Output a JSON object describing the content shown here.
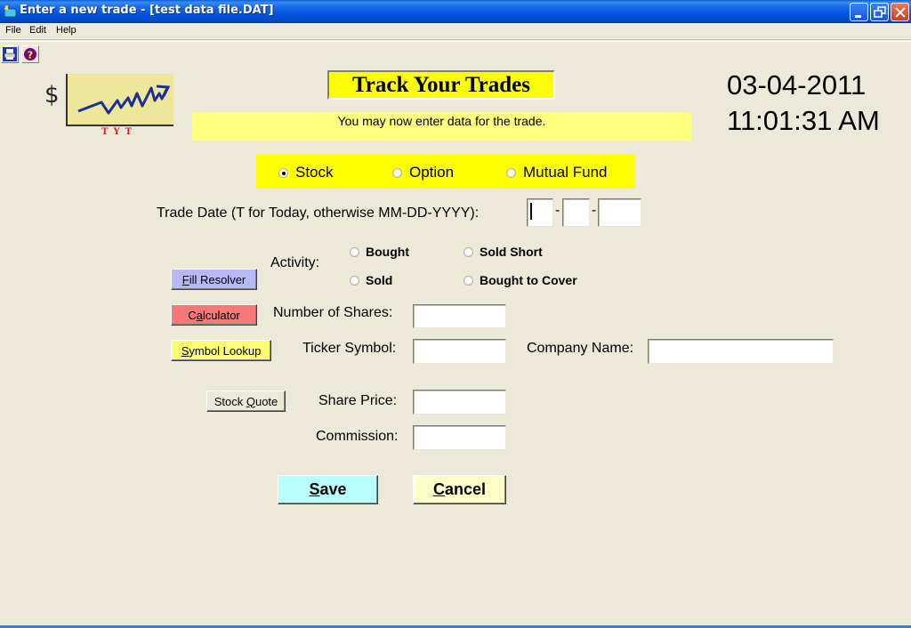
{
  "window": {
    "title": "Enter a new trade - [test data file.DAT]",
    "controls": {
      "minimize": "minimize",
      "restore": "restore",
      "close": "close"
    }
  },
  "menu": {
    "items": [
      {
        "label": "File"
      },
      {
        "label": "Edit"
      },
      {
        "label": "Help"
      }
    ]
  },
  "toolbar": {
    "buttons": [
      {
        "icon": "print-icon",
        "tooltip": "Print"
      },
      {
        "icon": "help-icon",
        "tooltip": "Help"
      }
    ]
  },
  "logo": {
    "symbol": "$",
    "caption": "TYT"
  },
  "header": {
    "title": "Track Your Trades",
    "status_message": "You may now enter data for the trade.",
    "date": "03-04-2011",
    "time": "11:01:31 AM"
  },
  "security_type": {
    "options": [
      {
        "label": "Stock",
        "checked": true
      },
      {
        "label": "Option",
        "checked": false
      },
      {
        "label": "Mutual Fund",
        "checked": false
      }
    ],
    "accent": "#ffff00"
  },
  "trade_date": {
    "label": "Trade Date (T for Today, otherwise MM-DD-YYYY):",
    "month": "",
    "day": "",
    "year": "",
    "separator": "-"
  },
  "activity": {
    "label": "Activity:",
    "options": [
      {
        "label": "Bought",
        "checked": false
      },
      {
        "label": "Sold Short",
        "checked": false
      },
      {
        "label": "Sold",
        "checked": false
      },
      {
        "label": "Bought to Cover",
        "checked": false
      }
    ]
  },
  "fields": {
    "shares": {
      "label": "Number of Shares:",
      "value": ""
    },
    "ticker": {
      "label": "Ticker Symbol:",
      "value": ""
    },
    "company": {
      "label": "Company Name:",
      "value": ""
    },
    "price": {
      "label": "Share Price:",
      "value": ""
    },
    "commission": {
      "label": "Commission:",
      "value": ""
    }
  },
  "buttons": {
    "fill_resolver": {
      "accel": "F",
      "rest": "ill Resolver",
      "color": "#b8b8f8"
    },
    "calculator": {
      "pre": "C",
      "accel": "a",
      "rest": "lculator",
      "color": "#f87878"
    },
    "symbol_lookup": {
      "accel": "S",
      "rest": "ymbol Lookup",
      "color": "#ffff70"
    },
    "stock_quote": {
      "pre": "Stock ",
      "accel": "Q",
      "rest": "uote",
      "color": "#ece9d8"
    },
    "save": {
      "accel": "S",
      "rest": "ave",
      "color": "#b8ffff"
    },
    "cancel": {
      "accel": "C",
      "rest": "ancel",
      "color": "#ffffc8"
    }
  }
}
